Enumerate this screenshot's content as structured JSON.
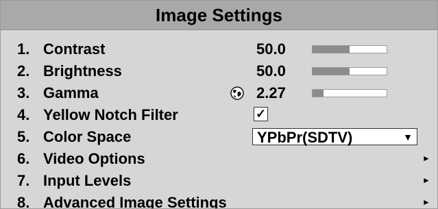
{
  "title": "Image Settings",
  "items": [
    {
      "num": "1.",
      "label": "Contrast",
      "value": "50.0",
      "level": 0.5
    },
    {
      "num": "2.",
      "label": "Brightness",
      "value": "50.0",
      "level": 0.5
    },
    {
      "num": "3.",
      "label": "Gamma",
      "value": "2.27",
      "level": 0.15,
      "icon": "globe-icon"
    },
    {
      "num": "4.",
      "label": "Yellow Notch Filter",
      "checked": true,
      "check_glyph": "✓"
    },
    {
      "num": "5.",
      "label": "Color Space",
      "selected": "YPbPr(SDTV)",
      "dropdown_arrow": "▼"
    },
    {
      "num": "6.",
      "label": "Video Options",
      "submenu_arrow": "►"
    },
    {
      "num": "7.",
      "label": "Input Levels",
      "submenu_arrow": "►"
    },
    {
      "num": "8.",
      "label": "Advanced Image Settings",
      "submenu_arrow": "►"
    }
  ]
}
